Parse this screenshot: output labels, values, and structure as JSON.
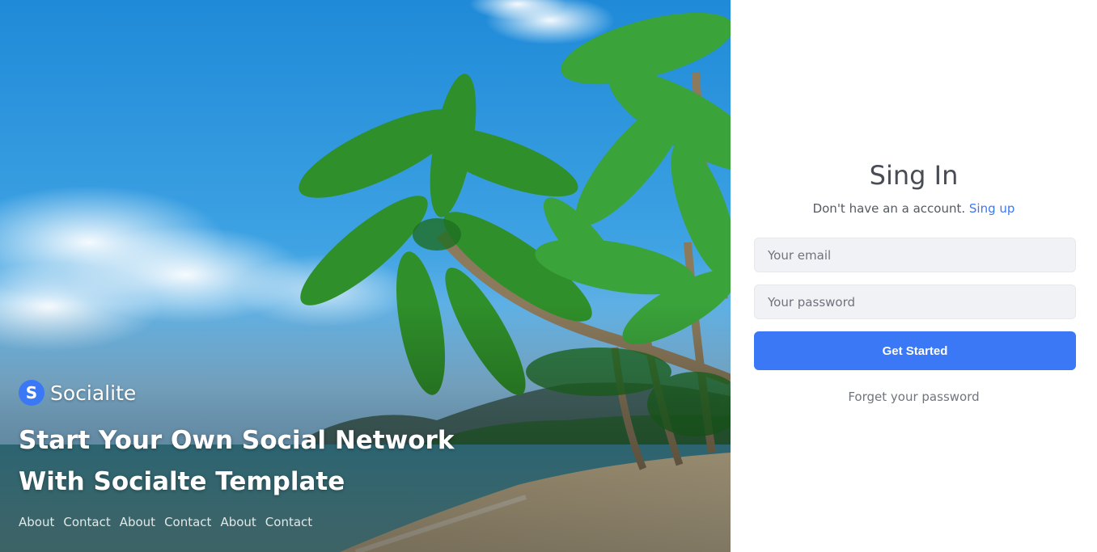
{
  "hero": {
    "brand_initial": "S",
    "brand_name": "Socialite",
    "headline_line1": "Start Your Own Social Network",
    "headline_line2": "With Socialte Template",
    "footer_links": [
      "About",
      "Contact",
      "About",
      "Contact",
      "About",
      "Contact"
    ]
  },
  "signin": {
    "title": "Sing In",
    "subtitle": "Don't have an a account.",
    "signup_link": "Sing up",
    "email_placeholder": "Your email",
    "password_placeholder": "Your password",
    "submit_label": "Get Started",
    "forgot_link": "Forget your password"
  },
  "colors": {
    "accent": "#3b78f6",
    "input_bg": "#f1f2f5",
    "title_text": "#484c54"
  },
  "icons": [
    "socialite-logo-icon"
  ]
}
